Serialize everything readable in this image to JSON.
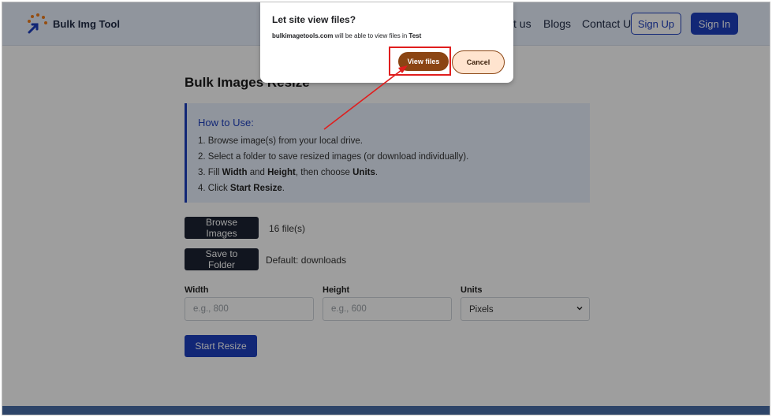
{
  "header": {
    "brand": "Bulk Img Tool",
    "nav_partial": "t us",
    "nav_blogs": "Blogs",
    "nav_contact": "Contact Us",
    "signup_label": "Sign Up",
    "signin_label": "Sign In"
  },
  "main": {
    "title": "Bulk Images Resize",
    "howto": {
      "heading": "How to Use:",
      "step1": "1. Browse image(s) from your local drive.",
      "step2": "2. Select a folder to save resized images (or download individually).",
      "step3_pre": "3. Fill ",
      "step3_width": "Width",
      "step3_and": " and ",
      "step3_height": "Height",
      "step3_mid": ", then choose ",
      "step3_units": "Units",
      "step3_end": ".",
      "step4_pre": "4. Click ",
      "step4_bold": "Start Resize",
      "step4_end": "."
    },
    "browse_label": "Browse Images",
    "file_count": "16 file(s)",
    "save_label": "Save to Folder",
    "save_default": "Default: downloads",
    "width_label": "Width",
    "width_placeholder": "e.g., 800",
    "height_label": "Height",
    "height_placeholder": "e.g., 600",
    "units_label": "Units",
    "units_selected": "Pixels",
    "start_label": "Start Resize"
  },
  "dialog": {
    "title": "Let site view files?",
    "site": "bulkimagetools.com",
    "message_mid": " will be able to view files in ",
    "folder": "Test",
    "view_label": "View files",
    "cancel_label": "Cancel"
  },
  "colors": {
    "accent": "#1d3fbf",
    "dialog_button": "#8b4513",
    "annotation": "#e01e1e"
  }
}
